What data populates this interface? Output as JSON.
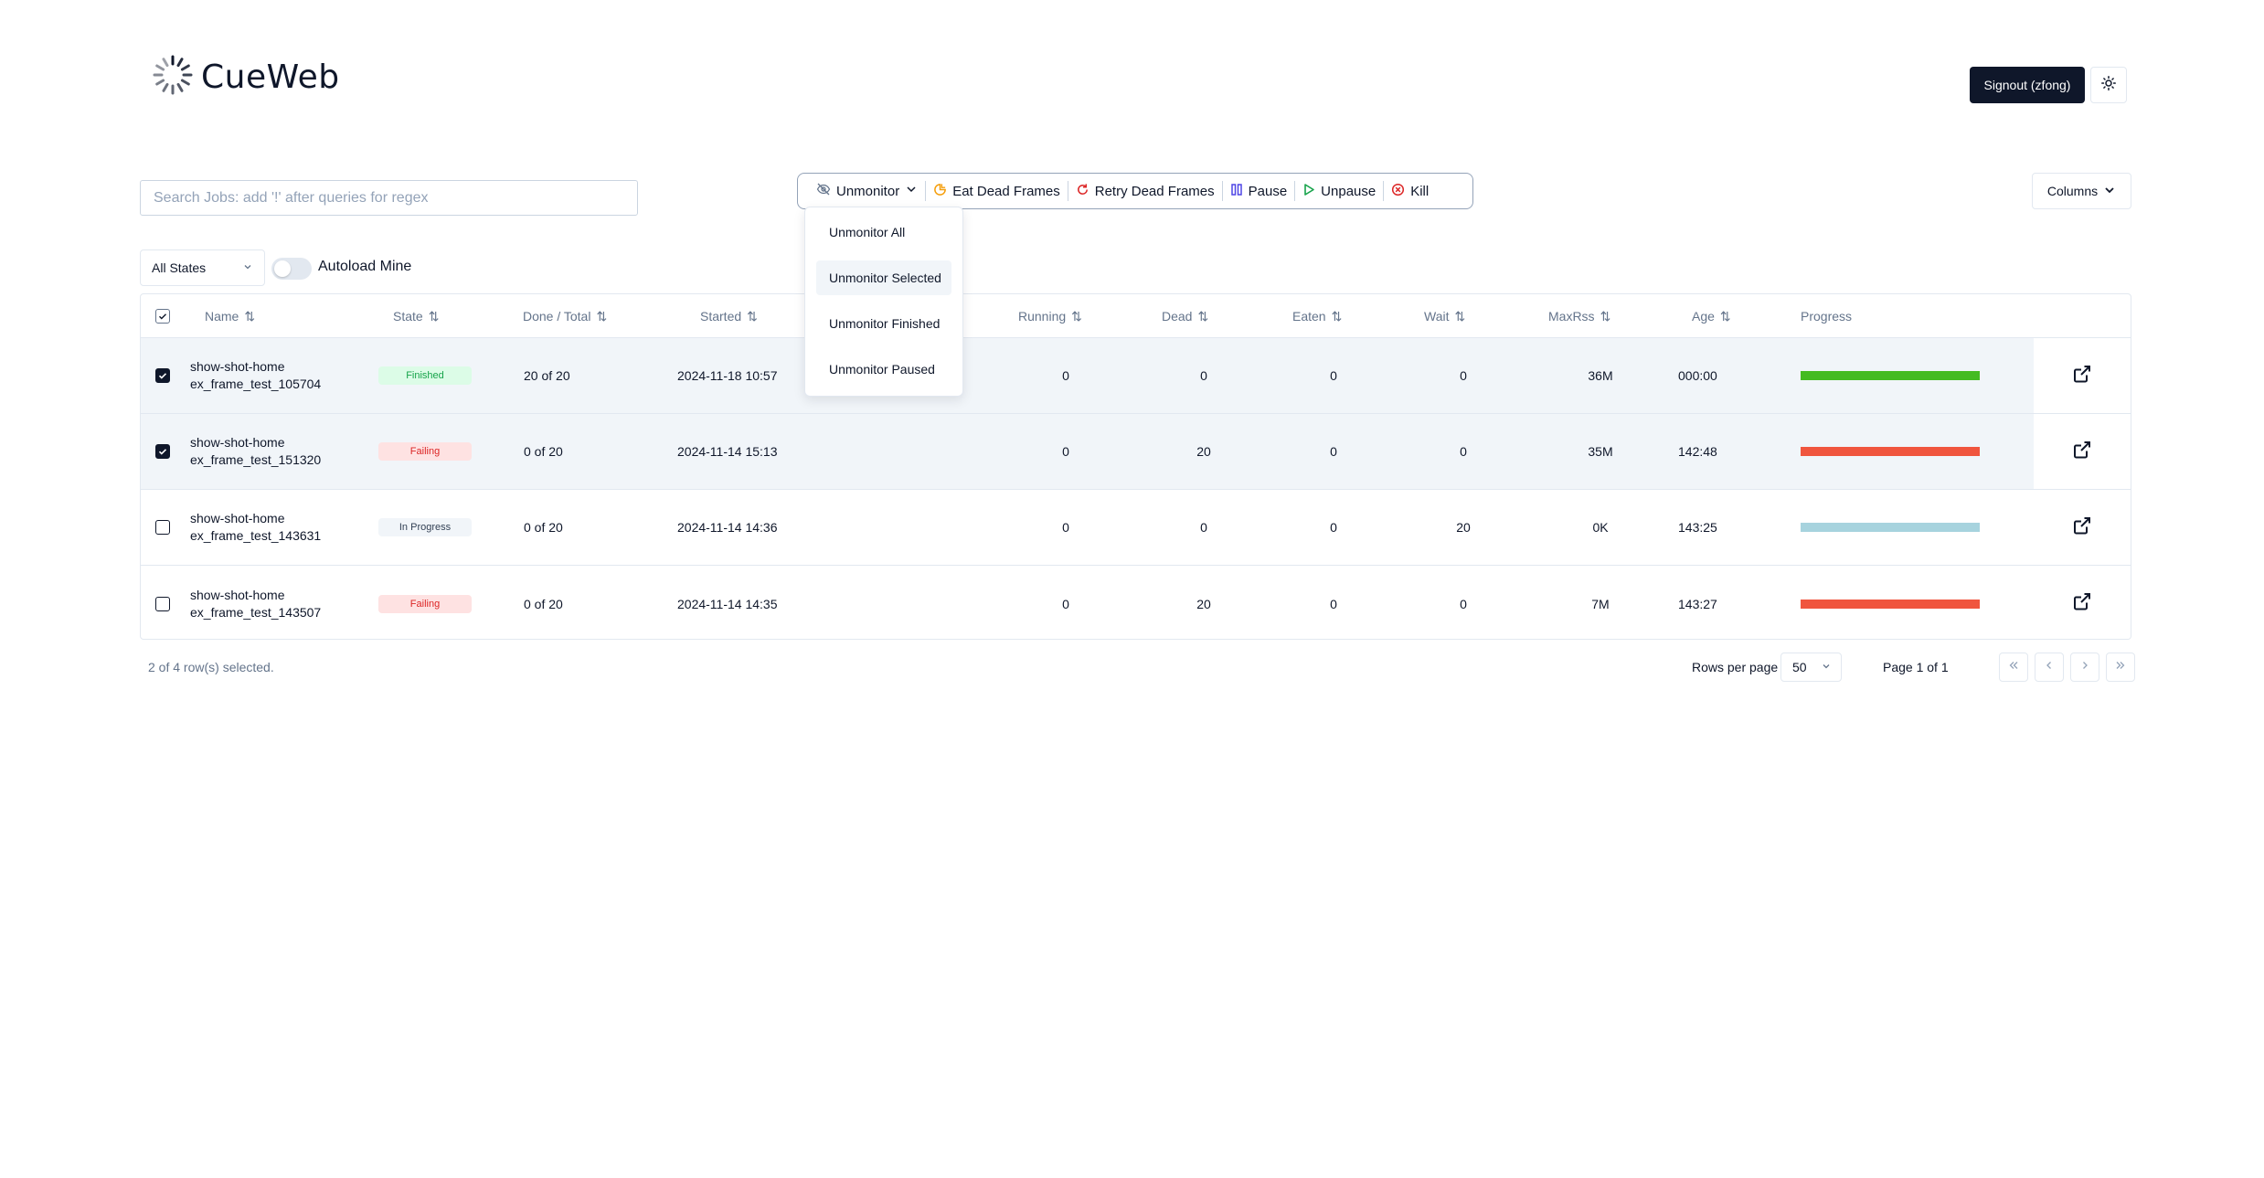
{
  "app": {
    "name": "CueWeb"
  },
  "header": {
    "signout_label": "Signout (zfong)",
    "theme_icon": "sun-icon"
  },
  "search": {
    "placeholder": "Search Jobs: add '!' after queries for regex",
    "value": ""
  },
  "toolbar": {
    "unmonitor_label": "Unmonitor",
    "eat_dead_label": "Eat Dead Frames",
    "retry_dead_label": "Retry Dead Frames",
    "pause_label": "Pause",
    "unpause_label": "Unpause",
    "kill_label": "Kill",
    "columns_label": "Columns",
    "colors": {
      "eat": "#f59e0b",
      "retry": "#dc2626",
      "pause": "#4f46e5",
      "unpause": "#16a34a",
      "kill": "#dc2626"
    }
  },
  "unmonitor_menu": {
    "items": [
      "Unmonitor All",
      "Unmonitor Selected",
      "Unmonitor Finished",
      "Unmonitor Paused"
    ],
    "highlighted": "Unmonitor Selected"
  },
  "filters": {
    "state_selected": "All States",
    "autoload_label": "Autoload Mine",
    "autoload_on": false
  },
  "table": {
    "columns": [
      "Name",
      "State",
      "Done / Total",
      "Started",
      "Running",
      "Dead",
      "Eaten",
      "Wait",
      "MaxRss",
      "Age",
      "Progress"
    ],
    "rows": [
      {
        "selected": true,
        "name1": "show-shot-home",
        "name2": "ex_frame_test_105704",
        "state": "Finished",
        "done_total": "20 of 20",
        "started": "2024-11-18 10:57",
        "running": "0",
        "dead": "0",
        "eaten": "0",
        "wait": "0",
        "maxrss": "36M",
        "age": "000:00",
        "progress_color": "#44bb22"
      },
      {
        "selected": true,
        "name1": "show-shot-home",
        "name2": "ex_frame_test_151320",
        "state": "Failing",
        "done_total": "0 of 20",
        "started": "2024-11-14 15:13",
        "running": "0",
        "dead": "20",
        "eaten": "0",
        "wait": "0",
        "maxrss": "35M",
        "age": "142:48",
        "progress_color": "#f0553e"
      },
      {
        "selected": false,
        "name1": "show-shot-home",
        "name2": "ex_frame_test_143631",
        "state": "In Progress",
        "done_total": "0 of 20",
        "started": "2024-11-14 14:36",
        "running": "0",
        "dead": "0",
        "eaten": "0",
        "wait": "20",
        "maxrss": "0K",
        "age": "143:25",
        "progress_color": "#a7d3de"
      },
      {
        "selected": false,
        "name1": "show-shot-home",
        "name2": "ex_frame_test_143507",
        "state": "Failing",
        "done_total": "0 of 20",
        "started": "2024-11-14 14:35",
        "running": "0",
        "dead": "20",
        "eaten": "0",
        "wait": "0",
        "maxrss": "7M",
        "age": "143:27",
        "progress_color": "#f0553e"
      }
    ],
    "state_colors": {
      "Finished": {
        "bg": "#dcfce7",
        "fg": "#16a34a"
      },
      "Failing": {
        "bg": "#fee2e2",
        "fg": "#dc2626"
      },
      "In Progress": {
        "bg": "#f1f5f9",
        "fg": "#334155"
      }
    }
  },
  "footer": {
    "selected_text": "2 of 4 row(s) selected.",
    "rows_per_page_label": "Rows per page",
    "rows_per_page_value": "50",
    "page_text": "Page 1 of 1"
  }
}
